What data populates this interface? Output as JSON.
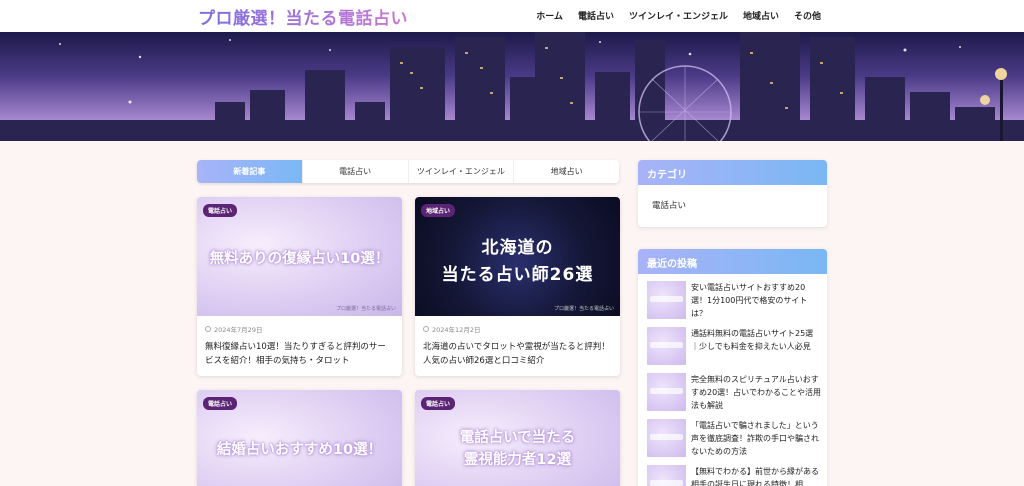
{
  "site": {
    "logo": "プロ厳選！当たる電話占い"
  },
  "nav": {
    "items": [
      "ホーム",
      "電話占い",
      "ツインレイ・エンジェル",
      "地域占い",
      "その他"
    ]
  },
  "tabs": [
    "新着記事",
    "電話占い",
    "ツインレイ・エンジェル",
    "地域占い"
  ],
  "cards": [
    {
      "badge": "電話占い",
      "thumb_text": "無料ありの復縁占い10選！",
      "thumb_foot": "プロ厳選！当たる電話占い",
      "date": "2024年7月29日",
      "title": "無料復縁占い10選！当たりすぎると評判のサービスを紹介！相手の気持ち・タロット"
    },
    {
      "badge": "地域占い",
      "thumb_line1": "北海道の",
      "thumb_line2": "当たる占い師26選",
      "thumb_foot": "プロ厳選！当たる電話占い",
      "date": "2024年12月2日",
      "title": "北海道の占いでタロットや霊視が当たると評判！人気の占い師26選と口コミ紹介"
    },
    {
      "badge": "電話占い",
      "thumb_text": "結婚占いおすすめ10選！"
    },
    {
      "badge": "電話占い",
      "thumb_line1": "電話占いで当たる",
      "thumb_line2": "霊視能力者12選"
    }
  ],
  "sidebar": {
    "category": {
      "heading": "カテゴリ",
      "items": [
        "電話占い"
      ]
    },
    "recent": {
      "heading": "最近の投稿",
      "posts": [
        "安い電話占いサイトおすすめ20選！1分100円代で格安のサイトは？",
        "通話料無料の電話占いサイト25選｜少しでも料金を抑えたい人必見",
        "完全無料のスピリチュアル占いおすすめ20選！占いでわかることや活用法も解説",
        "「電話占いで騙されました」という声を徹底調査！詐欺の手口や騙されないための方法",
        "【無料でわかる】前世から縁がある相手の誕生日に現れる特徴！相"
      ]
    }
  }
}
